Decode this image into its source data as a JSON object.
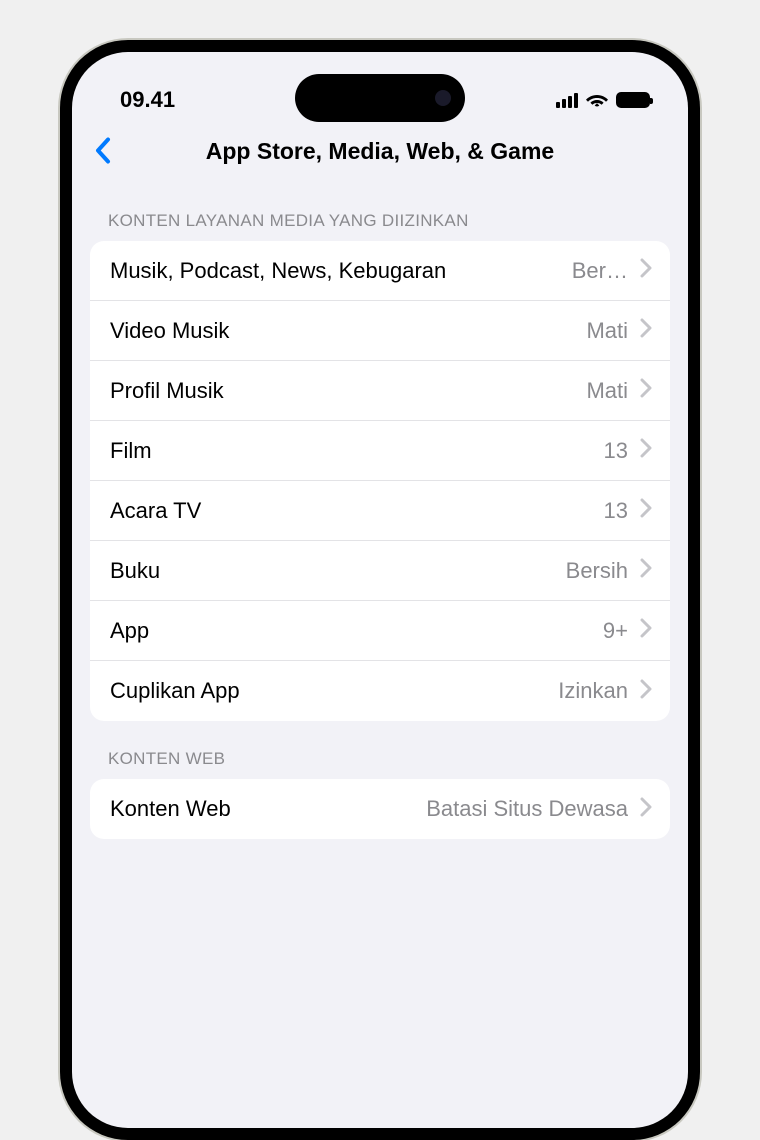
{
  "status": {
    "time": "09.41"
  },
  "nav": {
    "title": "App Store, Media, Web, & Game"
  },
  "sections": {
    "media": {
      "header": "KONTEN LAYANAN MEDIA YANG DIIZINKAN",
      "rows": [
        {
          "label": "Musik, Podcast, News, Kebugaran",
          "value": "Ber…"
        },
        {
          "label": "Video Musik",
          "value": "Mati"
        },
        {
          "label": "Profil Musik",
          "value": "Mati"
        },
        {
          "label": "Film",
          "value": "13"
        },
        {
          "label": "Acara TV",
          "value": "13"
        },
        {
          "label": "Buku",
          "value": "Bersih"
        },
        {
          "label": "App",
          "value": "9+"
        },
        {
          "label": "Cuplikan App",
          "value": "Izinkan"
        }
      ]
    },
    "web": {
      "header": "KONTEN WEB",
      "rows": [
        {
          "label": "Konten Web",
          "value": "Batasi Situs Dewasa"
        }
      ]
    }
  }
}
